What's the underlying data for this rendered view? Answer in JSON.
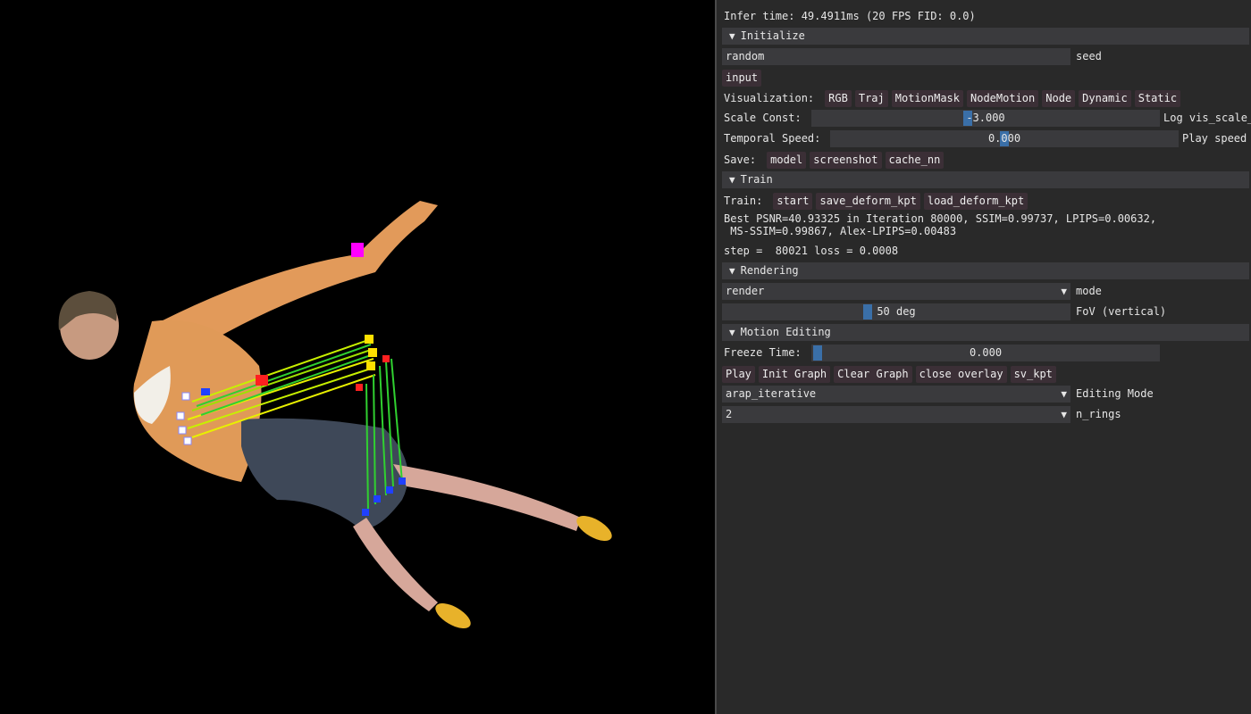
{
  "status": {
    "infer_time": "Infer time:  49.4911ms (20 FPS FID: 0.0)"
  },
  "initialize": {
    "header": "Initialize",
    "seed_value": "random",
    "seed_label": "seed",
    "input_button": "input",
    "visualization_label": "Visualization:",
    "visualization_options": [
      "RGB",
      "Traj",
      "MotionMask",
      "NodeMotion",
      "Node",
      "Dynamic",
      "Static"
    ],
    "scale_const_label": "Scale Const:",
    "scale_const_value": "-3.000",
    "scale_const_suffix": "Log vis_scale_",
    "temporal_speed_label": "Temporal Speed:",
    "temporal_speed_value": "0.000",
    "temporal_speed_suffix": "Play speed",
    "save_label": "Save:",
    "save_buttons": [
      "model",
      "screenshot",
      "cache_nn"
    ]
  },
  "train": {
    "header": "Train",
    "train_label": "Train:",
    "buttons": [
      "start",
      "save_deform_kpt",
      "load_deform_kpt"
    ],
    "metrics_line1": "Best PSNR=40.93325 in Iteration 80000, SSIM=0.99737, LPIPS=0.00632,",
    "metrics_line2": " MS-SSIM=0.99867, Alex-LPIPS=0.00483",
    "step_line": "step =  80021 loss = 0.0008"
  },
  "rendering": {
    "header": "Rendering",
    "mode_value": "render",
    "mode_label": "mode",
    "fov_value": "50 deg",
    "fov_label": "FoV (vertical)"
  },
  "motion_editing": {
    "header": "Motion Editing",
    "freeze_label": "Freeze Time:",
    "freeze_value": "0.000",
    "buttons": [
      "Play",
      "Init Graph",
      "Clear Graph",
      "close overlay",
      "sv_kpt"
    ],
    "editing_mode_value": "arap_iterative",
    "editing_mode_label": "Editing Mode",
    "n_rings_value": "2",
    "n_rings_label": "n_rings"
  },
  "colors": {
    "panel_bg": "#292929",
    "header_bg": "#3a3a3d",
    "button_bg": "#3b2f36",
    "slider_grab": "#3a6fa8"
  }
}
